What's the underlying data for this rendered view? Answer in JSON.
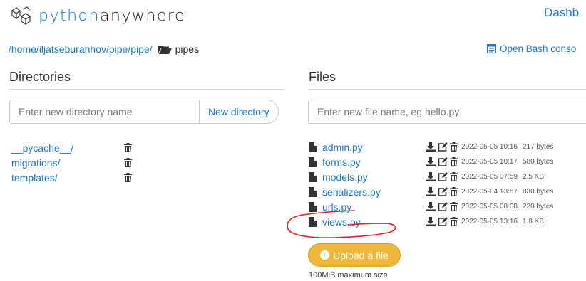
{
  "header": {
    "logo_part1": "python",
    "logo_part2": "anywhere",
    "dashboard_link": "Dashb"
  },
  "breadcrumb": {
    "segments": [
      "/home/",
      "iljatseburahhov",
      "/",
      "pipe",
      "/",
      "pipe",
      "/"
    ],
    "folder_icon": "folder-open-icon",
    "current": "pipes"
  },
  "bash": {
    "label": "Open Bash conso",
    "icon": "terminal-icon"
  },
  "directories": {
    "heading": "Directories",
    "input_placeholder": "Enter new directory name",
    "button_label": "New directory",
    "items": [
      {
        "name": "__pycache__/"
      },
      {
        "name": "migrations/"
      },
      {
        "name": "templates/"
      }
    ]
  },
  "files": {
    "heading": "Files",
    "input_placeholder": "Enter new file name, eg hello.py",
    "items": [
      {
        "name": "admin.py",
        "date": "2022-05-05 10:16",
        "size": "217 bytes"
      },
      {
        "name": "forms.py",
        "date": "2022-05-05 10:17",
        "size": "580 bytes"
      },
      {
        "name": "models.py",
        "date": "2022-05-05 07:59",
        "size": "2.5 KB"
      },
      {
        "name": "serializers.py",
        "date": "2022-05-04 13:57",
        "size": "830 bytes"
      },
      {
        "name": "urls.py",
        "date": "2022-05-05 08:08",
        "size": "220 bytes"
      },
      {
        "name": "views.py",
        "date": "2022-05-05 13:16",
        "size": "1.8 KB"
      }
    ],
    "upload_label": "Upload a file",
    "max_size": "100MiB maximum size"
  },
  "colors": {
    "link": "#1a77c9",
    "upload_button": "#f0b73e",
    "annotation": "#e0211e"
  }
}
